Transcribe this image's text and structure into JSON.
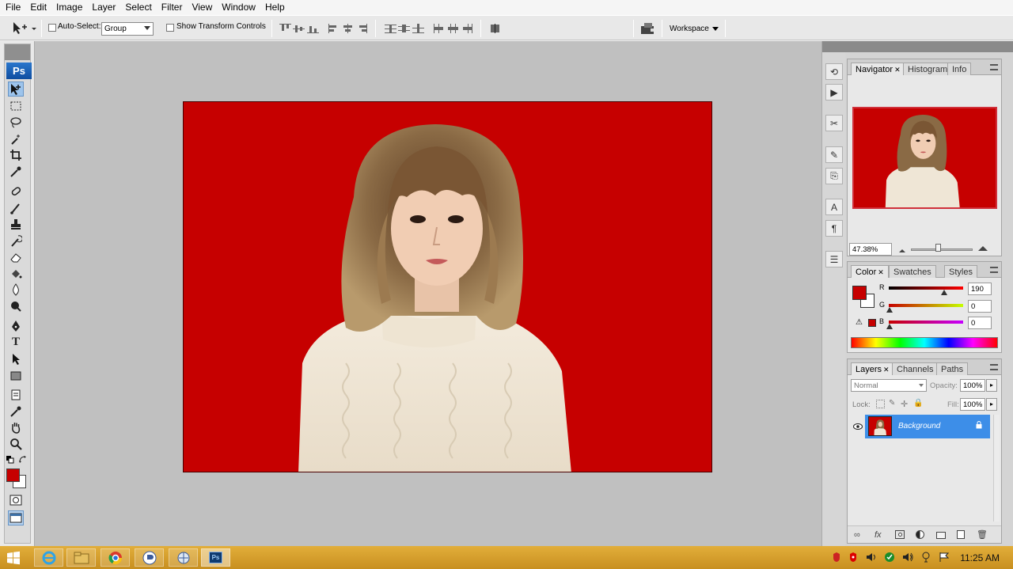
{
  "menu": [
    "File",
    "Edit",
    "Image",
    "Layer",
    "Select",
    "Filter",
    "View",
    "Window",
    "Help"
  ],
  "options": {
    "auto_select_label": "Auto-Select:",
    "auto_select_value": "Group",
    "transform_label": "Show Transform Controls",
    "workspace_label": "Workspace"
  },
  "toolbox": {
    "logo": "Ps"
  },
  "navigator": {
    "tabs": [
      "Navigator",
      "Histogram",
      "Info"
    ],
    "zoom": "47.38%"
  },
  "color": {
    "tabs": [
      "Color",
      "Swatches",
      "Styles"
    ],
    "r_label": "R",
    "g_label": "G",
    "b_label": "B",
    "r": "190",
    "g": "0",
    "b": "0",
    "fg_hex": "#c60000"
  },
  "layers": {
    "tabs": [
      "Layers",
      "Channels",
      "Paths"
    ],
    "blend_mode": "Normal",
    "opacity_label": "Opacity:",
    "opacity": "100%",
    "lock_label": "Lock:",
    "fill_label": "Fill:",
    "fill": "100%",
    "layer_name": "Background"
  },
  "taskbar": {
    "time": "11:25 AM"
  }
}
